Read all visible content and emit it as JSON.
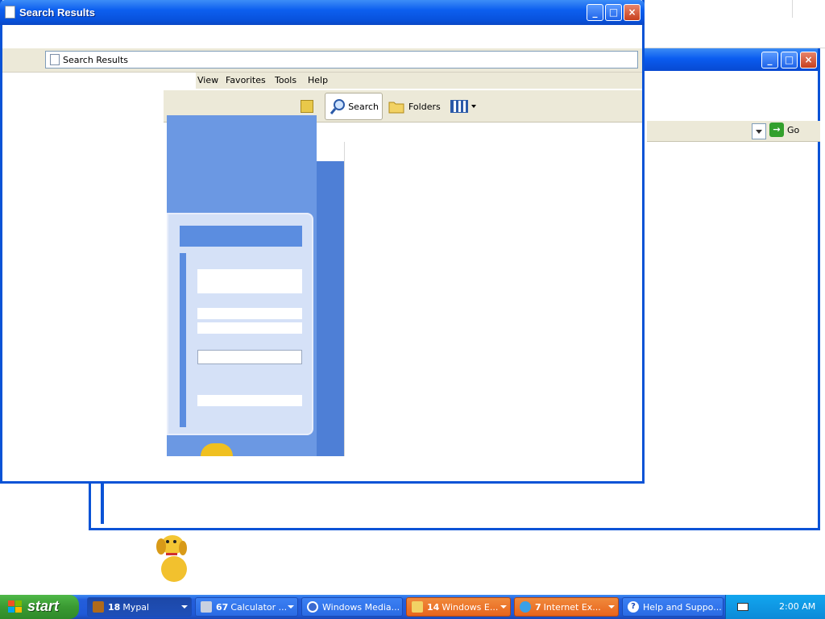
{
  "main_window": {
    "title": "Search Results",
    "address": "Search Results",
    "menu": [
      "View",
      "Favorites",
      "Tools",
      "Help"
    ],
    "toolbar": {
      "search": "Search",
      "folders": "Folders"
    }
  },
  "back_window": {
    "go_label": "Go"
  },
  "taskbar": {
    "start_label": "start",
    "tasks": [
      {
        "count": "18",
        "label": "Mypal"
      },
      {
        "count": "67",
        "label": "Calculator ..."
      },
      {
        "count": "",
        "label": "Windows Media..."
      },
      {
        "count": "14",
        "label": "Windows E..."
      },
      {
        "count": "7",
        "label": "Internet Ex..."
      },
      {
        "count": "",
        "label": "Help and Suppo..."
      }
    ],
    "clock": "2:00 AM"
  },
  "colors": {
    "title_blue": "#0a53d6",
    "taskbar_blue": "#245edb",
    "start_green": "#3a9a32",
    "flash_orange": "#e8641c"
  }
}
